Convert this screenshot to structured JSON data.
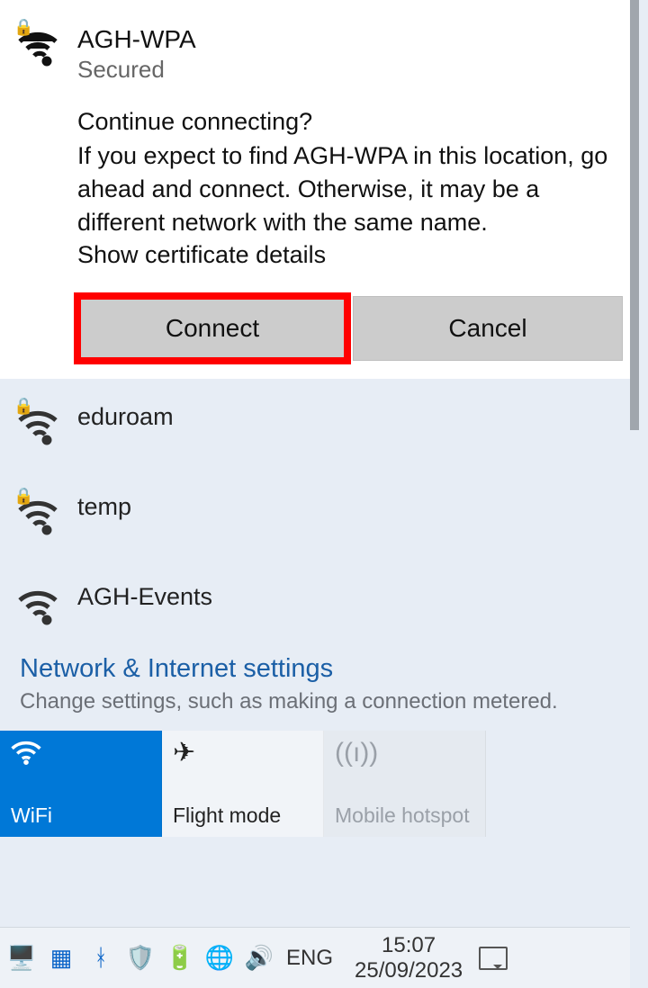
{
  "selected_network": {
    "name": "AGH-WPA",
    "status": "Secured",
    "secured": true,
    "prompt_title": "Continue connecting?",
    "prompt_body": "If you expect to find AGH-WPA in this location, go ahead and connect. Otherwise, it may be a different network with the same name.",
    "cert_link": "Show certificate details",
    "connect_label": "Connect",
    "cancel_label": "Cancel",
    "connect_highlighted": true
  },
  "other_networks": [
    {
      "name": "eduroam",
      "secured": true
    },
    {
      "name": "temp",
      "secured": true
    },
    {
      "name": "AGH-Events",
      "secured": false
    }
  ],
  "settings": {
    "title": "Network & Internet settings",
    "description": "Change settings, such as making a connection metered."
  },
  "tiles": {
    "wifi": {
      "label": "WiFi",
      "state": "active"
    },
    "flight": {
      "label": "Flight mode",
      "state": "inactive"
    },
    "hotspot": {
      "label": "Mobile hotspot",
      "state": "disabled"
    }
  },
  "taskbar": {
    "language": "ENG",
    "time": "15:07",
    "date": "25/09/2023"
  }
}
